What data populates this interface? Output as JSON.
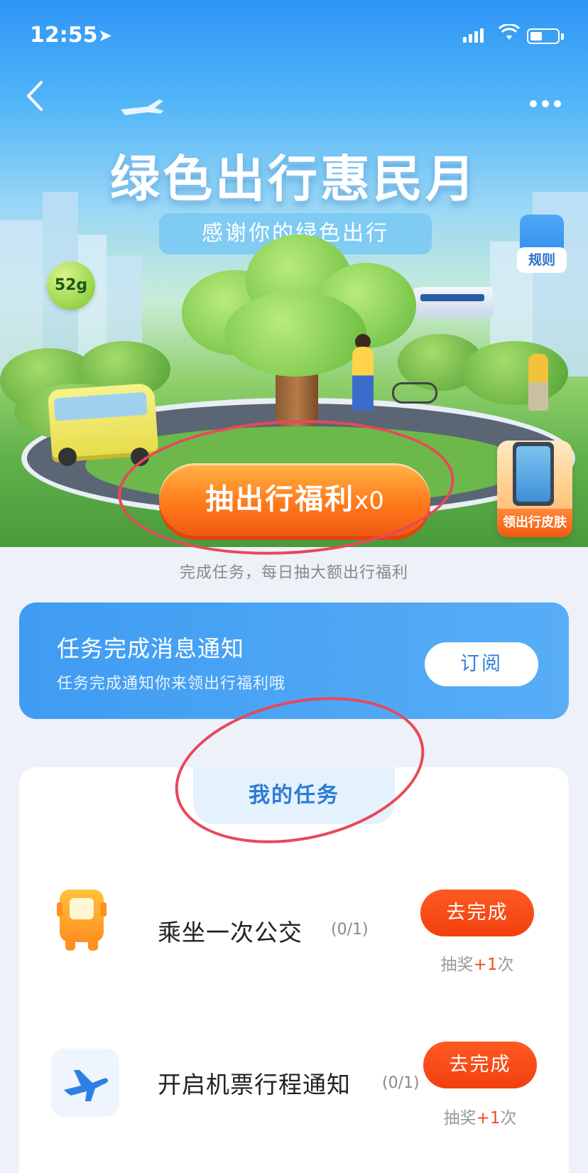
{
  "status_bar": {
    "time": "12:55"
  },
  "hero": {
    "title": "绿色出行惠民月",
    "subtitle": "感谢你的绿色出行",
    "co2_badge": "52g",
    "rules_label": "规则",
    "draw_button_label": "抽出行福利",
    "draw_count": "x0",
    "skin_label": "领出行皮肤",
    "caption": "完成任务，每日抽大额出行福利"
  },
  "notification": {
    "title": "任务完成消息通知",
    "description": "任务完成通知你来领出行福利哦",
    "subscribe_label": "订阅"
  },
  "tasks": {
    "tab_label": "我的任务",
    "items": [
      {
        "icon": "bus-icon",
        "name": "乘坐一次公交",
        "progress": "(0/1)",
        "button": "去完成",
        "reward_prefix": "抽奖",
        "reward_plus": "+1",
        "reward_suffix": "次"
      },
      {
        "icon": "airplane-icon",
        "name": "开启机票行程通知",
        "progress": "(0/1)",
        "button": "去完成",
        "reward_prefix": "抽奖",
        "reward_plus": "+1",
        "reward_suffix": "次"
      }
    ]
  },
  "colors": {
    "accent_blue": "#3f9cf2",
    "action_orange": "#f2400e",
    "annotation_red": "#e8485a"
  }
}
